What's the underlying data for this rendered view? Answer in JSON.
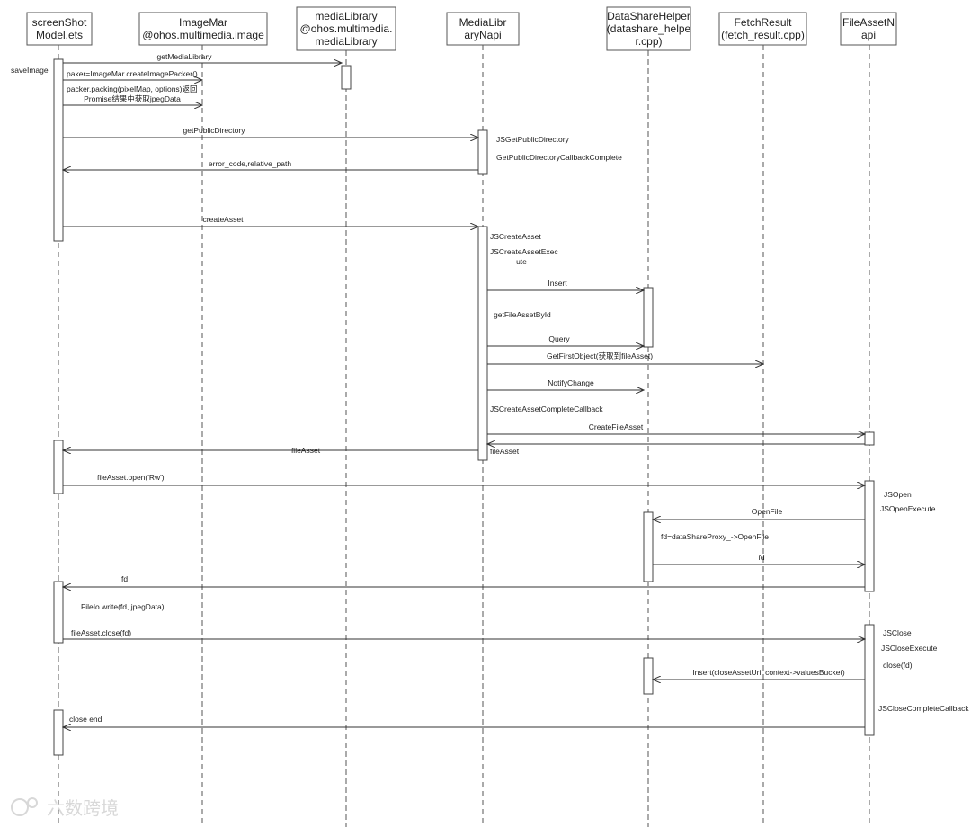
{
  "participants": [
    {
      "id": "p0",
      "lines": [
        "screenShot",
        "Model.ets"
      ]
    },
    {
      "id": "p1",
      "lines": [
        "ImageMar",
        "@ohos.multimedia.image"
      ]
    },
    {
      "id": "p2",
      "lines": [
        "mediaLibrary",
        "@ohos.multimedia.",
        "mediaLibrary"
      ]
    },
    {
      "id": "p3",
      "lines": [
        "MediaLibr",
        "aryNapi"
      ]
    },
    {
      "id": "p4",
      "lines": [
        "DataShareHelper",
        "(datashare_helpe",
        "r.cpp)"
      ]
    },
    {
      "id": "p5",
      "lines": [
        "FetchResult",
        "(fetch_result.cpp)"
      ]
    },
    {
      "id": "p6",
      "lines": [
        "FileAssetN",
        "api"
      ]
    }
  ],
  "messages": [
    {
      "from": "p0",
      "to": "p2",
      "lines": [
        "getMediaLibrary"
      ]
    },
    {
      "from": "p0",
      "to": "p1",
      "lines": [
        "paker=ImageMar.createImagePacker()"
      ]
    },
    {
      "from": "p0",
      "to": "p1",
      "lines": [
        "packer.packing(pixelMap, options)返回",
        "Promise结果中获取jpegData"
      ]
    },
    {
      "from": "p0",
      "to": "p3",
      "lines": [
        "getPublicDirectory"
      ]
    },
    {
      "from": "p3",
      "to": "p0",
      "lines": [
        "error_code,relative_path"
      ]
    },
    {
      "from": "p0",
      "to": "p3",
      "lines": [
        "createAsset"
      ]
    },
    {
      "from": "p3",
      "to": "p4",
      "lines": [
        "Insert"
      ]
    },
    {
      "from": "p3",
      "to": "p4",
      "lines": [
        "Query"
      ]
    },
    {
      "from": "p3",
      "to": "p5",
      "lines": [
        "GetFirstObject(获取到fileAsset)"
      ]
    },
    {
      "from": "p3",
      "to": "p4",
      "lines": [
        "NotifyChange"
      ]
    },
    {
      "from": "p3",
      "to": "p6",
      "lines": [
        "CreateFileAsset"
      ]
    },
    {
      "from": "p6",
      "to": "p3",
      "lines": [
        "fileAsset"
      ]
    },
    {
      "from": "p3",
      "to": "p0",
      "lines": [
        "fileAsset"
      ]
    },
    {
      "from": "p0",
      "to": "p6",
      "lines": [
        "fileAsset.open('Rw')"
      ]
    },
    {
      "from": "p6",
      "to": "p4",
      "lines": [
        "OpenFile"
      ]
    },
    {
      "from": "p4",
      "to": "p6",
      "lines": [
        "fd"
      ]
    },
    {
      "from": "p6",
      "to": "p0",
      "lines": [
        "fd"
      ]
    },
    {
      "from": "p0",
      "to": "p6",
      "lines": [
        "fileAsset.close(fd)"
      ]
    },
    {
      "from": "p6",
      "to": "p4",
      "lines": [
        "Insert(closeAssetUri, context->valuesBucket)"
      ]
    },
    {
      "from": "p6",
      "to": "p0",
      "lines": [
        "close end"
      ]
    }
  ],
  "notes": [
    {
      "lines": [
        "saveImage"
      ]
    },
    {
      "lines": [
        "JSGetPublicDirectory"
      ]
    },
    {
      "lines": [
        "GetPublicDirectoryCallbackComplete"
      ]
    },
    {
      "lines": [
        "JSCreateAsset"
      ]
    },
    {
      "lines": [
        "JSCreateAssetExec",
        "ute"
      ]
    },
    {
      "lines": [
        "getFileAssetById"
      ]
    },
    {
      "lines": [
        "JSCreateAssetCompleteCallback"
      ]
    },
    {
      "lines": [
        "FileIo.write(fd, jpegData)"
      ],
      "color": "#1aa1d6"
    },
    {
      "lines": [
        "JSOpen"
      ]
    },
    {
      "lines": [
        "JSOpenExecute"
      ]
    },
    {
      "lines": [
        "fd=dataShareProxy_->OpenFile"
      ]
    },
    {
      "lines": [
        "JSClose"
      ]
    },
    {
      "lines": [
        "JSCloseExecute"
      ]
    },
    {
      "lines": [
        "close(fd)"
      ]
    },
    {
      "lines": [
        "JSCloseCompleteCallback"
      ]
    }
  ],
  "watermark": {
    "text": "六数跨境"
  },
  "colors": {
    "line": "#333333",
    "highlight_note": "#1aa1d6"
  }
}
